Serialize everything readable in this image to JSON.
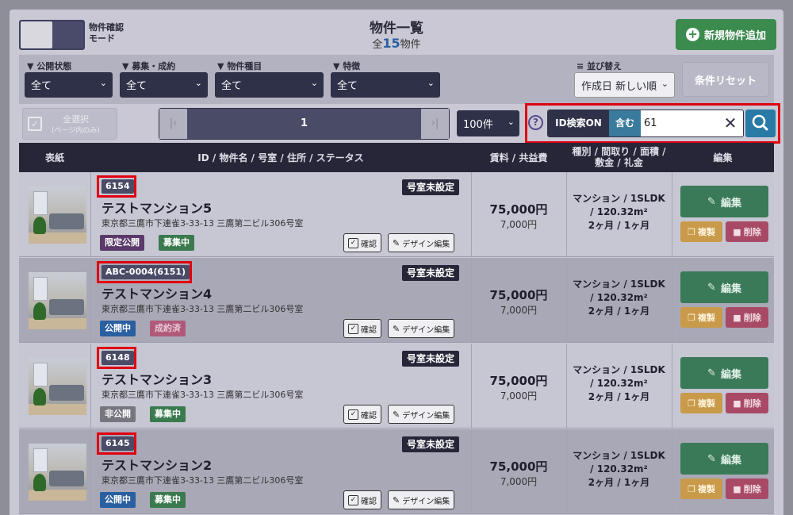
{
  "header": {
    "mode_toggle_label_line1": "物件確認",
    "mode_toggle_label_line2": "モード",
    "title": "物件一覧",
    "count_prefix": "全",
    "count_number": "15",
    "count_suffix": "物件",
    "add_button_label": "新規物件追加"
  },
  "filters": {
    "public_status": {
      "label": "公開状態",
      "value": "全て"
    },
    "recruit": {
      "label": "募集・成約",
      "value": "全て"
    },
    "property_type": {
      "label": "物件種目",
      "value": "全て"
    },
    "features": {
      "label": "特徴",
      "value": "全て"
    },
    "sort": {
      "label": "並び替え",
      "value": "作成日 新しい順"
    },
    "reset_label": "条件リセット"
  },
  "toolbar": {
    "select_all_line1": "全選択",
    "select_all_line2": "(ページ内のみ)",
    "pager_prev": "|‹",
    "pager_page": "1",
    "pager_next": "›|",
    "per_page": "100件",
    "help": "?",
    "id_search_label": "ID検索ON",
    "match_mode": "含む",
    "search_value": "61"
  },
  "table": {
    "headers": {
      "cover": "表紙",
      "info": "ID / 物件名 / 号室 / 住所 / ステータス",
      "rent": "賃料 / 共益費",
      "spec_line1": "種別 / 間取り / 面積 /",
      "spec_line2": "敷金 / 礼金",
      "edit": "編集"
    },
    "rows": [
      {
        "id": "6154",
        "room_badge": "号室未設定",
        "name": "テストマンション5",
        "address": "東京都三鷹市下連雀3-33-13 三鷹第二ビル306号室",
        "status1": "限定公開",
        "status2": "募集中",
        "confirm": "確認",
        "design_edit": "デザイン編集",
        "rent": "75,000円",
        "fee": "7,000円",
        "spec1": "マンション / 1SLDK",
        "spec2": "/ 120.32m²",
        "spec3": "2ヶ月 / 1ヶ月",
        "edit": "編集",
        "copy": "複製",
        "delete": "削除"
      },
      {
        "id": "ABC-0004(6151)",
        "room_badge": "号室未設定",
        "name": "テストマンション4",
        "address": "東京都三鷹市下連雀3-33-13 三鷹第二ビル306号室",
        "status1": "公開中",
        "status2": "成約済",
        "confirm": "確認",
        "design_edit": "デザイン編集",
        "rent": "75,000円",
        "fee": "7,000円",
        "spec1": "マンション / 1SLDK",
        "spec2": "/ 120.32m²",
        "spec3": "2ヶ月 / 1ヶ月",
        "edit": "編集",
        "copy": "複製",
        "delete": "削除"
      },
      {
        "id": "6148",
        "room_badge": "号室未設定",
        "name": "テストマンション3",
        "address": "東京都三鷹市下連雀3-33-13 三鷹第二ビル306号室",
        "status1": "非公開",
        "status2": "募集中",
        "confirm": "確認",
        "design_edit": "デザイン編集",
        "rent": "75,000円",
        "fee": "7,000円",
        "spec1": "マンション / 1SLDK",
        "spec2": "/ 120.32m²",
        "spec3": "2ヶ月 / 1ヶ月",
        "edit": "編集",
        "copy": "複製",
        "delete": "削除"
      },
      {
        "id": "6145",
        "room_badge": "号室未設定",
        "name": "テストマンション2",
        "address": "東京都三鷹市下連雀3-33-13 三鷹第二ビル306号室",
        "status1": "公開中",
        "status2": "募集中",
        "confirm": "確認",
        "design_edit": "デザイン編集",
        "rent": "75,000円",
        "fee": "7,000円",
        "spec1": "マンション / 1SLDK",
        "spec2": "/ 120.32m²",
        "spec3": "2ヶ月 / 1ヶ月",
        "edit": "編集",
        "copy": "複製",
        "delete": "削除"
      }
    ]
  }
}
